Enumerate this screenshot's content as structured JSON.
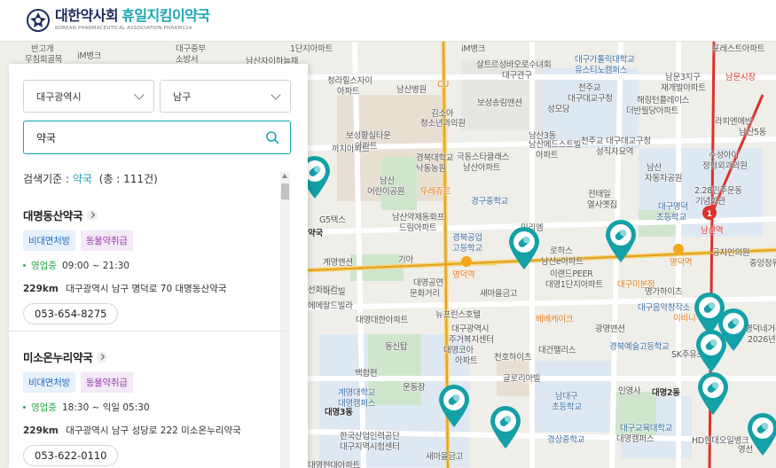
{
  "header": {
    "org_name": "대한약사회",
    "service_name": "휴일지킴이약국",
    "subtitle": "KOREAN PHARMACEUTICAL ASSOCIATION PHARM114"
  },
  "filters": {
    "region": "대구광역시",
    "district": "남구"
  },
  "search": {
    "value": "약국"
  },
  "results": {
    "prefix": "검색기준 : ",
    "keyword": "약국",
    "count_text": "(총 : 111건)"
  },
  "pharmacies": [
    {
      "name": "대명동산약국",
      "badge1": "비대면처방",
      "badge2": "동물약취급",
      "status": "영업중",
      "hours": "09:00 ~ 21:30",
      "distance": "229km",
      "address": "대구광역시 남구 명덕로 70 대명동산약국",
      "phone": "053-654-8275"
    },
    {
      "name": "미소온누리약국",
      "badge1": "비대면처방",
      "badge2": "동물약취급",
      "status": "영업중",
      "hours": "18:30 ~ 익일 05:30",
      "distance": "229km",
      "address": "대구광역시 남구 성당로 222 미소온누리약국",
      "phone": "053-622-0110"
    }
  ],
  "map_labels": {
    "l1": "반고개",
    "l2": "무침회골목",
    "l3": "iM뱅크",
    "l4": "대구중부",
    "l5": "소방서",
    "l6": "남산자이하늘채",
    "l7": "1단지아파트",
    "l8": "청라힐스자이",
    "l9": "아파트",
    "l10": "남산병원",
    "l11": "CU",
    "l12": "김소아",
    "l13": "청소년과의원",
    "l14": "보성송림맨션",
    "l15": "iM뱅크",
    "l16": "샬트르성바오로수녀회",
    "l17": "대구관구",
    "l18": "대구가톨릭대학교",
    "l19": "유스티노캠퍼스",
    "l20": "천주교",
    "l21": "대구대교구청",
    "l22": "성모당",
    "l23": "남문3지구",
    "l24": "재개발아파트",
    "l25": "남문시장",
    "l26": "포레스트아파트",
    "l27": "해링턴플레이스",
    "l28": "더반월당아파트",
    "l29": "라피엔에빈",
    "l30": "남산5동",
    "l31": "보성황실타운",
    "l32": "아파트",
    "l33": "까치아파트",
    "l34": "경북대학교",
    "l35": "낙동농원",
    "l36": "극동스타클래스",
    "l37": "남산아파트",
    "l38": "남산3동",
    "l39": "남산메드스트빌",
    "l40": "아파트",
    "l41": "천주교 대구대교구청",
    "l42": "성직자묘역",
    "l43": "남산",
    "l44": "자동차공원",
    "l45": "수성아이",
    "l46": "정형외과의원",
    "l47": "남산",
    "l48": "어린이공원",
    "l49": "뚜레쥬르",
    "l50": "경구중학교",
    "l51": "전태일",
    "l52": "열사옛집",
    "l53": "대구명덕",
    "l54": "초등학교",
    "l55": "2.28민주운동",
    "l56": "기념회관",
    "l57": "남산역",
    "l58": "G5텍스",
    "l59": "남산약제동화프",
    "l60": "드림아파트",
    "l61": "경북공업",
    "l62": "고등학교",
    "l63": "미리엠",
    "l64": "로하스",
    "l65": "남산e아파트",
    "l66": "계명맨션",
    "l67": "기아",
    "l68": "대명공연",
    "l69": "문화거리",
    "l70": "명덕역",
    "l71": "이랜드PEER",
    "l72": "대명1단지아파트",
    "l73": "대구미본점",
    "l74": "명가하이츠",
    "l75": "공지인의원",
    "l76": "중앙정워",
    "l77": "새마을금고",
    "l78": "뉴프린스호텔",
    "l79": "대구광역시",
    "l80": "주거복지센터",
    "l81": "대구음악창작소",
    "l82": "이비니",
    "l83": "베베케이크",
    "l84": "광명맨션",
    "l85": "대명코아",
    "l86": "아파트",
    "l87": "천호하이츠",
    "l88": "대건팰리스",
    "l89": "경북예술고등학교",
    "l90": "SK주유소",
    "l91": "명덕네거리",
    "l92": "2026년",
    "l93": "동신탑",
    "l94": "백합편",
    "l95": "남대구",
    "l96": "초등학교",
    "l97": "계명대학교",
    "l98": "대명캠퍼스",
    "l99": "운동장",
    "l100": "대명3동",
    "l101": "글로리아빌",
    "l102": "대명2동",
    "l103": "한국산업인력공단",
    "l104": "대구지역시험센터",
    "l105": "새마을금고",
    "l106": "경상중학교",
    "l107": "대구교육대학교",
    "l108": "HD현대오일뱅크",
    "l109": "영선",
    "l110": "대명캠퍼스",
    "l111": "약국",
    "l112": "선화빌라",
    "l113": "아드빌",
    "l114": "에메랄드빌라",
    "l115": "대명대한아파트",
    "l116": "대명현대아파트",
    "l117": "명덕역",
    "l118": "인영사"
  },
  "colors": {
    "accent": "#1aa6b2",
    "brand_navy": "#1f2d5c",
    "open_green": "#2aa84a",
    "pin_teal": "#13a0a6"
  }
}
